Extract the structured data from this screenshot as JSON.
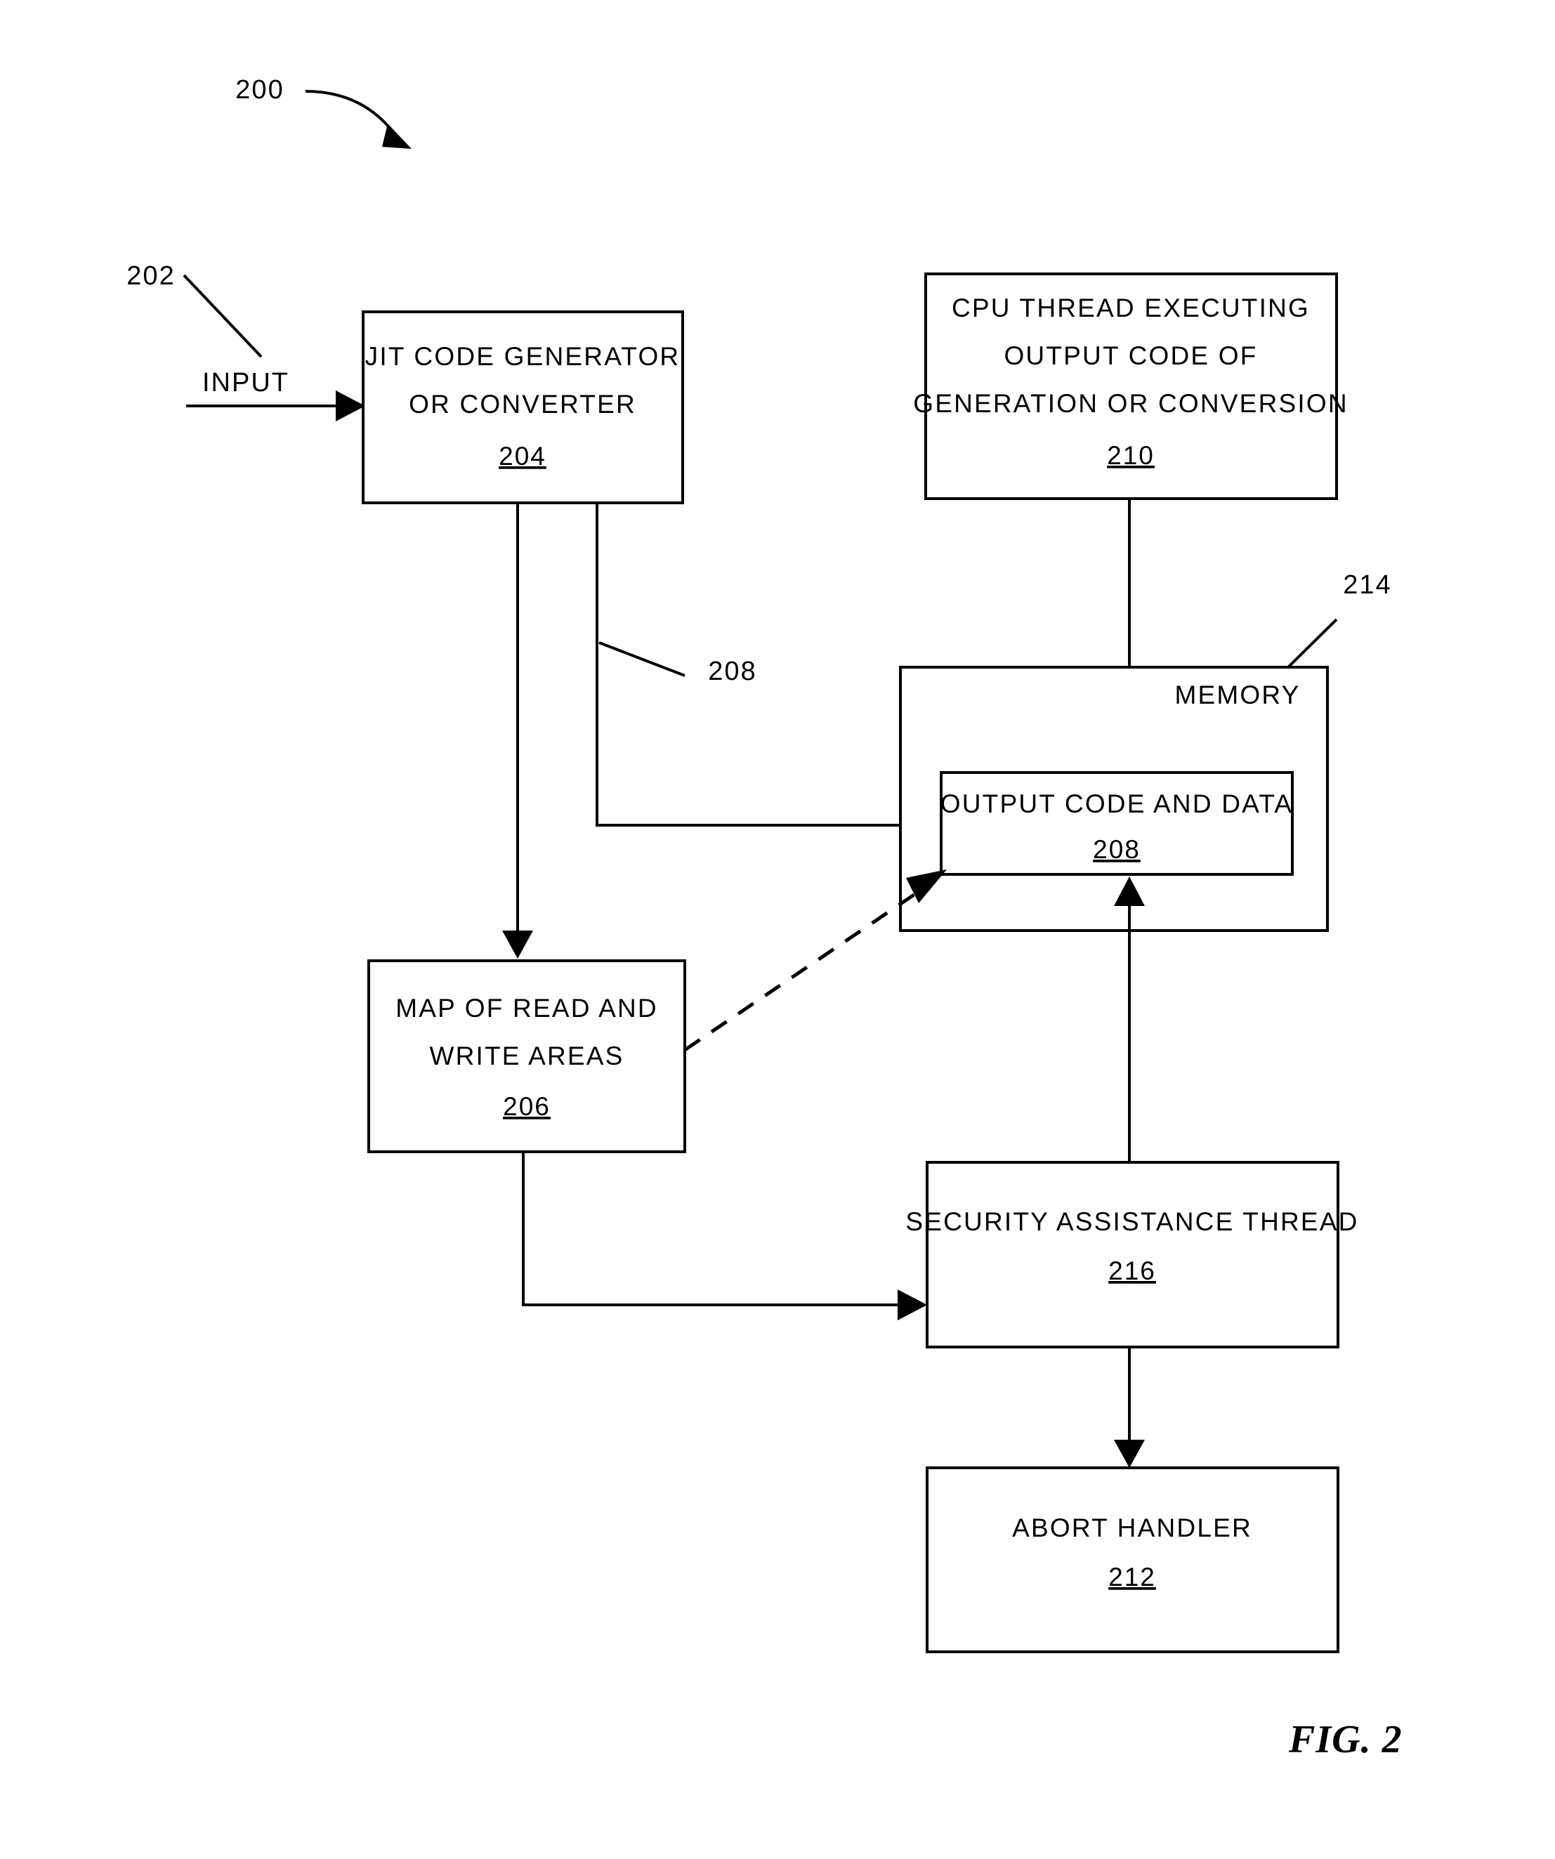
{
  "figure": {
    "caption": "FIG. 2",
    "diagram_number": "200",
    "input_label": "INPUT",
    "input_ref": "202",
    "memory_label": "MEMORY",
    "memory_ref": "214",
    "output_flow_ref": "208"
  },
  "boxes": {
    "jit": {
      "line1": "JIT CODE GENERATOR",
      "line2": "OR CONVERTER",
      "ref": "204"
    },
    "cpu_thread": {
      "line1": "CPU THREAD EXECUTING",
      "line2": "OUTPUT CODE OF",
      "line3": "GENERATION OR CONVERSION",
      "ref": "210"
    },
    "output_code": {
      "line1": "OUTPUT CODE AND DATA",
      "ref": "208"
    },
    "map_areas": {
      "line1": "MAP OF READ AND",
      "line2": "WRITE AREAS",
      "ref": "206"
    },
    "security_thread": {
      "line1": "SECURITY ASSISTANCE THREAD",
      "ref": "216"
    },
    "abort_handler": {
      "line1": "ABORT HANDLER",
      "ref": "212"
    }
  }
}
